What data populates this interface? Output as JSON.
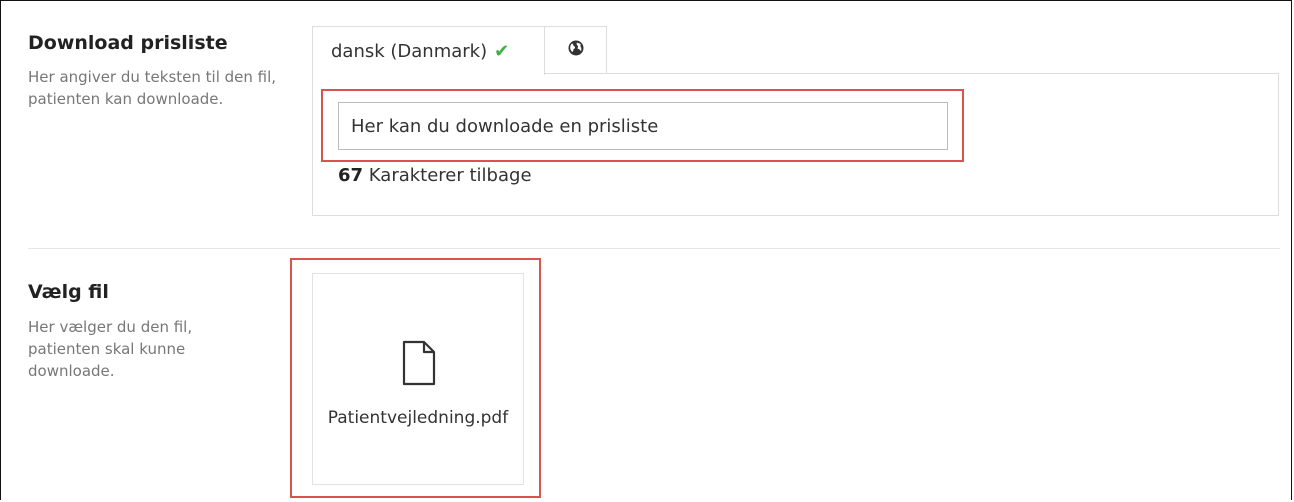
{
  "download_section": {
    "title": "Download prisliste",
    "description": "Her angiver du teksten til den fil, patienten kan downloade.",
    "tabs": [
      {
        "label": "dansk (Danmark)",
        "status_icon": "check-icon",
        "active": true
      },
      {
        "label": "",
        "icon": "globe-icon",
        "active": false
      }
    ],
    "input_value": "Her kan du downloade en prisliste",
    "counter_number": "67",
    "counter_text": "Karakterer tilbage"
  },
  "file_section": {
    "title": "Vælg fil",
    "description": "Her vælger du den fil, patienten skal kunne downloade.",
    "file_icon": "file-icon",
    "file_name": "Patientvejledning.pdf"
  },
  "colors": {
    "highlight": "#d9534f",
    "check": "#3cb043"
  }
}
